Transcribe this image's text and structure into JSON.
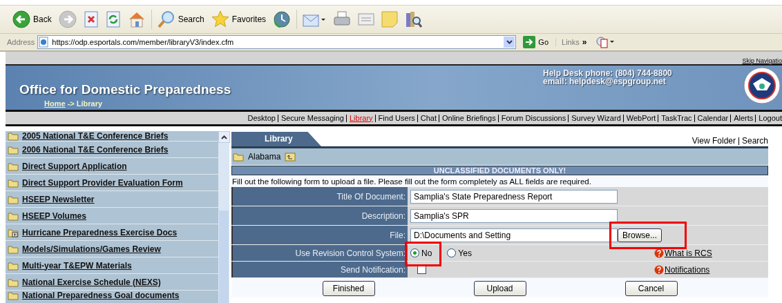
{
  "toolbar": {
    "buttons": [
      {
        "kind": "back",
        "label": "Back"
      },
      {
        "kind": "forward"
      },
      {
        "kind": "stop"
      },
      {
        "kind": "refresh"
      },
      {
        "kind": "home"
      },
      {
        "kind": "search",
        "label": "Search"
      },
      {
        "kind": "favorites",
        "label": "Favorites"
      },
      {
        "kind": "history"
      },
      {
        "kind": "mail"
      },
      {
        "kind": "print"
      },
      {
        "kind": "edit"
      },
      {
        "kind": "notes"
      },
      {
        "kind": "research"
      }
    ]
  },
  "address_bar": {
    "label": "Address",
    "url": "https://odp.esportals.com/member/libraryV3/index.cfm",
    "go": "Go",
    "links": "Links",
    "links_chevron": "»"
  },
  "header": {
    "skip_link": "Skip Navigatio",
    "title": "Office for Domestic Preparedness",
    "breadcrumb_home": "Home",
    "breadcrumb_rest": "-> Library",
    "helpdesk_phone": "Help Desk phone: (804) 744-8800",
    "helpdesk_email": "email: helpdesk@espgroup.net"
  },
  "nav": {
    "items": [
      {
        "label": "Desktop",
        "selected": false
      },
      {
        "label": "Secure Messaging",
        "selected": false
      },
      {
        "label": "Library",
        "selected": true
      },
      {
        "label": "Find Users",
        "selected": false
      },
      {
        "label": "Chat",
        "selected": false
      },
      {
        "label": "Online Briefings",
        "selected": false
      },
      {
        "label": "Forum Discussions",
        "selected": false
      },
      {
        "label": "Survey Wizard",
        "selected": false
      },
      {
        "label": "WebPort",
        "selected": false
      },
      {
        "label": "TaskTrac",
        "selected": false
      },
      {
        "label": "Calendar",
        "selected": false
      },
      {
        "label": "Alerts",
        "selected": false
      },
      {
        "label": "Logout",
        "selected": false
      }
    ]
  },
  "sidebar": {
    "items": [
      {
        "label": "2005 National T&E Conference Briefs",
        "kind": "folder"
      },
      {
        "label": "2006 National T&E Conference Briefs",
        "kind": "folder"
      },
      {
        "label": "Direct Support Application",
        "kind": "folder"
      },
      {
        "label": "Direct Support Provider Evaluation Form",
        "kind": "folder"
      },
      {
        "label": "HSEEP Newsletter",
        "kind": "folder"
      },
      {
        "label": "HSEEP Volumes",
        "kind": "folder"
      },
      {
        "label": "Hurricane Preparedness Exercise Docs",
        "kind": "folder-plus"
      },
      {
        "label": "Models/Simulations/Games Review",
        "kind": "folder"
      },
      {
        "label": "Multi-year T&EPW Materials",
        "kind": "folder"
      },
      {
        "label": "National Exercise Schedule (NEXS)",
        "kind": "folder"
      },
      {
        "label": "National Preparedness Goal documents",
        "kind": "folder"
      }
    ]
  },
  "library": {
    "tab": "Library",
    "links": [
      "View Folder",
      "Search"
    ],
    "folder": "Alabama",
    "banner": "UNCLASSIFIED DOCUMENTS ONLY!",
    "instructions": "Fill out the following form to upload a file. Please fill out the form completely as ALL fields are required.",
    "form": {
      "title": {
        "label": "Title Of Document:",
        "value": "Samplia's State Preparedness Report"
      },
      "description": {
        "label": "Description:",
        "value": "Samplia's SPR"
      },
      "file": {
        "label": "File:",
        "value": "D:\\Documents and Setting",
        "browse": "Browse...",
        "browse_highlighted": true
      },
      "revision_control": {
        "label": "Use Revision Control System:",
        "options": [
          {
            "label": "No",
            "selected": true,
            "highlighted": true
          },
          {
            "label": "Yes",
            "selected": false,
            "highlighted": false
          }
        ],
        "help": "What is RCS"
      },
      "notification": {
        "label": "Send Notification:",
        "checked": false,
        "help": "Notifications"
      }
    },
    "buttons": [
      "Finished",
      "Upload",
      "Cancel"
    ]
  }
}
